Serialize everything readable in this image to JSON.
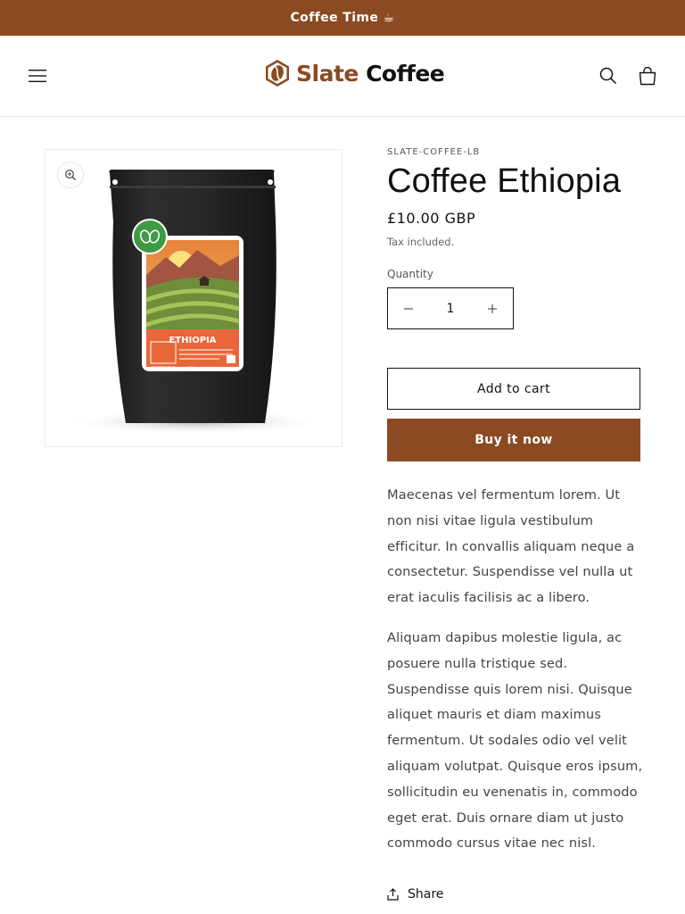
{
  "announcement": {
    "text": "Coffee Time ☕"
  },
  "header": {
    "logo_word1": "Slate",
    "logo_word2": "Coffee",
    "menu_icon": "hamburger-icon",
    "search_icon": "search-icon",
    "cart_icon": "cart-icon"
  },
  "product": {
    "vendor": "SLATE-COFFEE-LB",
    "title": "Coffee Ethiopia",
    "price": "£10.00 GBP",
    "tax_note": "Tax included.",
    "quantity_label": "Quantity",
    "quantity_value": "1",
    "add_to_cart": "Add to cart",
    "buy_now": "Buy it now",
    "image": {
      "bag_label": "ETHIOPIA",
      "brand": "COFFEE STAR",
      "weight": "250g"
    },
    "description": [
      "Maecenas vel fermentum lorem. Ut non nisi vitae ligula vestibulum efficitur. In convallis aliquam neque a consectetur. Suspendisse vel nulla ut erat iaculis facilisis ac a libero.",
      "Aliquam dapibus molestie ligula, ac posuere nulla tristique sed. Suspendisse quis lorem nisi. Quisque aliquet mauris et diam maximus fermentum. Ut sodales odio vel velit aliquam volutpat. Quisque eros ipsum, sollicitudin eu venenatis in, commodo eget erat. Duis ornare diam ut justo commodo cursus vitae nec nisl."
    ],
    "share_label": "Share"
  },
  "colors": {
    "brand": "#8b4a22",
    "text": "#121212"
  }
}
